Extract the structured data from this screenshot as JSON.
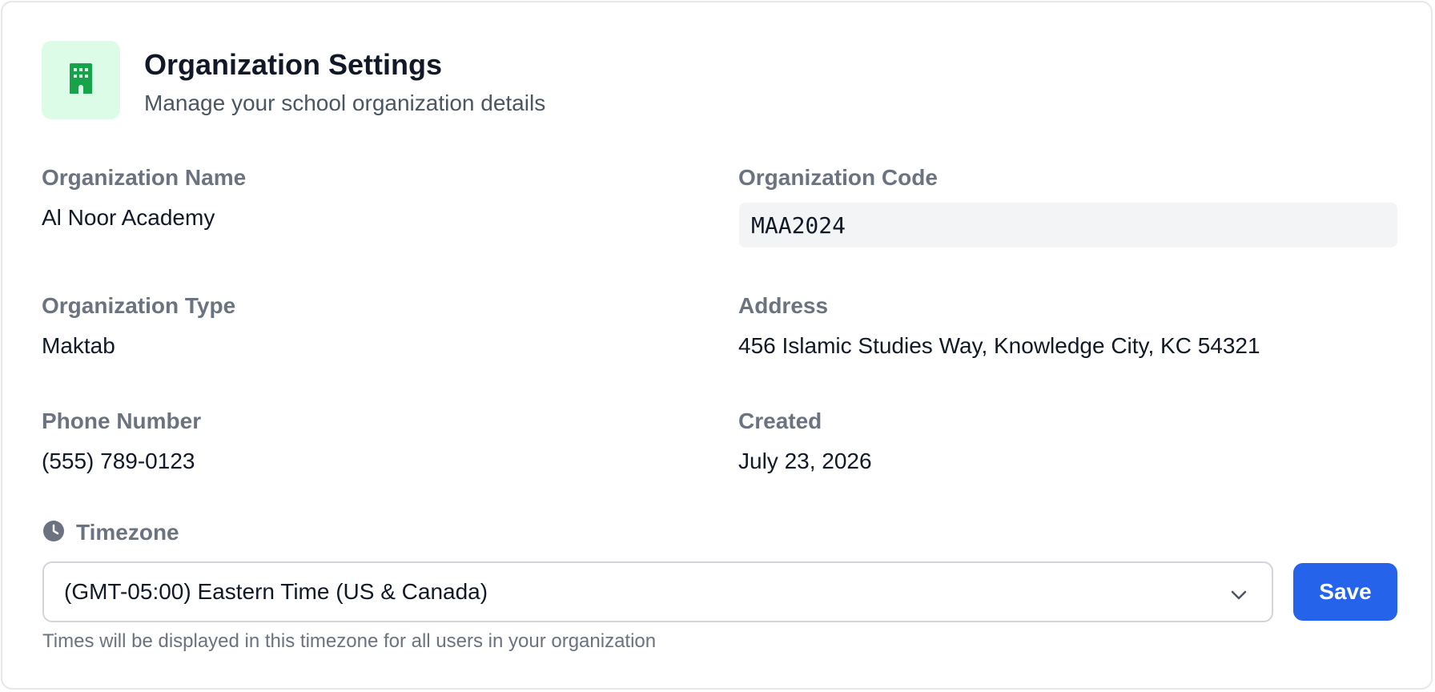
{
  "header": {
    "title": "Organization Settings",
    "subtitle": "Manage your school organization details",
    "icon": "building-icon",
    "icon_color": "#16a34a",
    "icon_bg": "#dcfce7"
  },
  "fields": {
    "name": {
      "label": "Organization Name",
      "value": "Al Noor Academy"
    },
    "code": {
      "label": "Organization Code",
      "value": "MAA2024"
    },
    "type": {
      "label": "Organization Type",
      "value": "Maktab"
    },
    "address": {
      "label": "Address",
      "value": "456 Islamic Studies Way, Knowledge City, KC 54321"
    },
    "phone": {
      "label": "Phone Number",
      "value": "(555) 789-0123"
    },
    "created": {
      "label": "Created",
      "value": "July 23, 2026"
    }
  },
  "timezone": {
    "label": "Timezone",
    "icon": "clock-icon",
    "selected": "(GMT-05:00) Eastern Time (US & Canada)",
    "help": "Times will be displayed in this timezone for all users in your organization",
    "save_label": "Save"
  },
  "colors": {
    "accent": "#2563eb",
    "label": "#6b7280",
    "text": "#111827"
  }
}
